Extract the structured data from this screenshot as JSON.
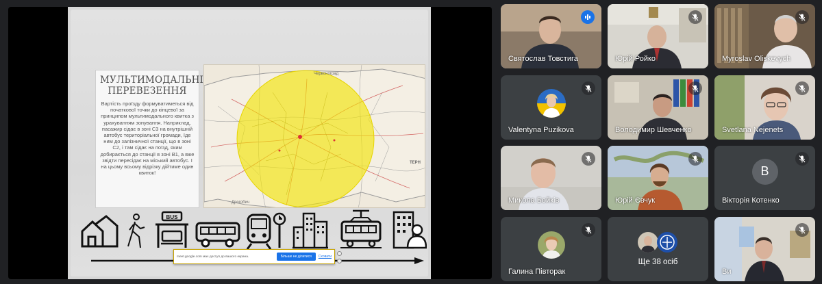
{
  "slide": {
    "title": "МУЛЬТИМОДАЛЬНІ ПЕРЕВЕЗЕННЯ",
    "body": "Вартість проїзду формуватиметься від початкової точки до кінцевої за принципом мультимодального квитка з урахуванням зонування. Наприклад, пасажир сідає в зоні C3 на внутрішній автобус територіальної громади, їде ним до залізничної станції, що в зоні C2, і там сідає на поїзд, яким добирається до станції в зоні B1, а вже звідти пересідає на міський автобус. І на цьому всьому відрізку дійтиме один квиток!",
    "map_labels": [
      "Червоноград",
      "Дрогобич",
      "ТЕРН"
    ]
  },
  "share_bar": {
    "message": "meet.google.com має доступ до вашого екрана.",
    "stop_label": "Більше не ділитися",
    "hide_label": "Сховати"
  },
  "participants": [
    {
      "name": "Святослав Товстига",
      "muted": false
    },
    {
      "name": "Юрій Ройко",
      "muted": true
    },
    {
      "name": "Myroslav Oliskevych",
      "muted": true
    },
    {
      "name": "Valentyna Puzikova",
      "muted": true
    },
    {
      "name": "Володимир Шевченко",
      "muted": true
    },
    {
      "name": "Svetlana Nejenets",
      "muted": true
    },
    {
      "name": "Микола Бойків",
      "muted": true
    },
    {
      "name": "Юрій Євчук",
      "muted": true
    },
    {
      "name": "Вікторія Котенко",
      "muted": true,
      "initial": "В"
    },
    {
      "name": "Галина Півторак",
      "muted": true
    },
    {
      "name": "Ви",
      "muted": true
    }
  ],
  "more_tile": {
    "label": "Ще 38 осіб"
  },
  "colors": {
    "background": "#202124",
    "tile": "#3c4043",
    "accent": "#1a73e8",
    "speaking_outline": "#8ab4f8"
  }
}
